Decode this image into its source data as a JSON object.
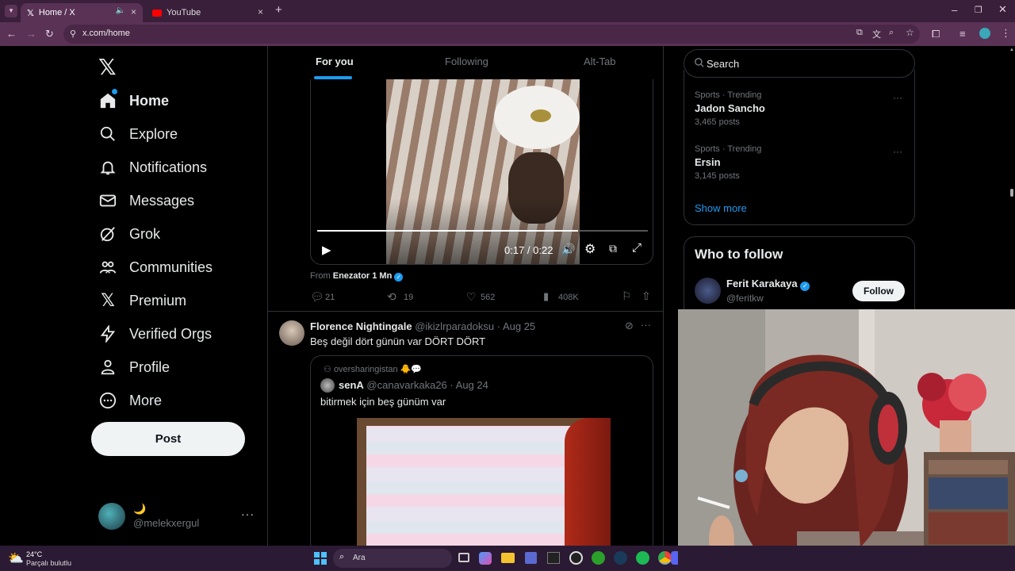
{
  "browser": {
    "tabs": [
      {
        "title": "Home / X"
      },
      {
        "title": "YouTube"
      }
    ],
    "url": "x.com/home"
  },
  "sidebar": {
    "items": [
      {
        "label": "Home",
        "icon": "home-icon"
      },
      {
        "label": "Explore",
        "icon": "search-icon"
      },
      {
        "label": "Notifications",
        "icon": "bell-icon"
      },
      {
        "label": "Messages",
        "icon": "mail-icon"
      },
      {
        "label": "Grok",
        "icon": "grok-icon"
      },
      {
        "label": "Communities",
        "icon": "communities-icon"
      },
      {
        "label": "Premium",
        "icon": "x-icon"
      },
      {
        "label": "Verified Orgs",
        "icon": "lightning-icon"
      },
      {
        "label": "Profile",
        "icon": "person-icon"
      },
      {
        "label": "More",
        "icon": "more-circle-icon"
      }
    ],
    "post_label": "Post",
    "account": {
      "name": "🌙",
      "handle": "@melekxergul"
    }
  },
  "feed": {
    "tabs": [
      "For you",
      "Following",
      "Alt-Tab"
    ],
    "video": {
      "time": "0:17 / 0:22"
    },
    "from_prefix": "From",
    "from_name": "Enezator 1 Mn",
    "actions1": {
      "replies": "21",
      "reposts": "19",
      "likes": "562",
      "views": "408K"
    },
    "post2": {
      "name": "Florence Nightingale",
      "handle": "@ikizlrparadoksu",
      "date": "· Aug 25",
      "text": "Beş değil dört günün var DÖRT DÖRT",
      "quote": {
        "community": "oversharingistan 🐥💬",
        "name": "senA",
        "handle": "@canavarkaka26",
        "date": "· Aug 24",
        "text": "bitirmek için beş günüm var"
      }
    }
  },
  "right": {
    "search_placeholder": "Search",
    "trends": [
      {
        "category": "Sports · Trending",
        "name": "Jadon Sancho",
        "posts": "3,465 posts"
      },
      {
        "category": "Sports · Trending",
        "name": "Ersin",
        "posts": "3,145 posts"
      }
    ],
    "show_more": "Show more",
    "who_title": "Who to follow",
    "follow": {
      "name": "Ferit Karakaya",
      "handle": "@feritkw",
      "button": "Follow"
    }
  },
  "taskbar": {
    "temp": "24°C",
    "weather": "Parçalı bulutlu",
    "search": "Ara"
  },
  "colors": {
    "accent": "#1d9bf0",
    "tab_bg": "#3a1f3a",
    "taskbar": "#2b1a33"
  }
}
